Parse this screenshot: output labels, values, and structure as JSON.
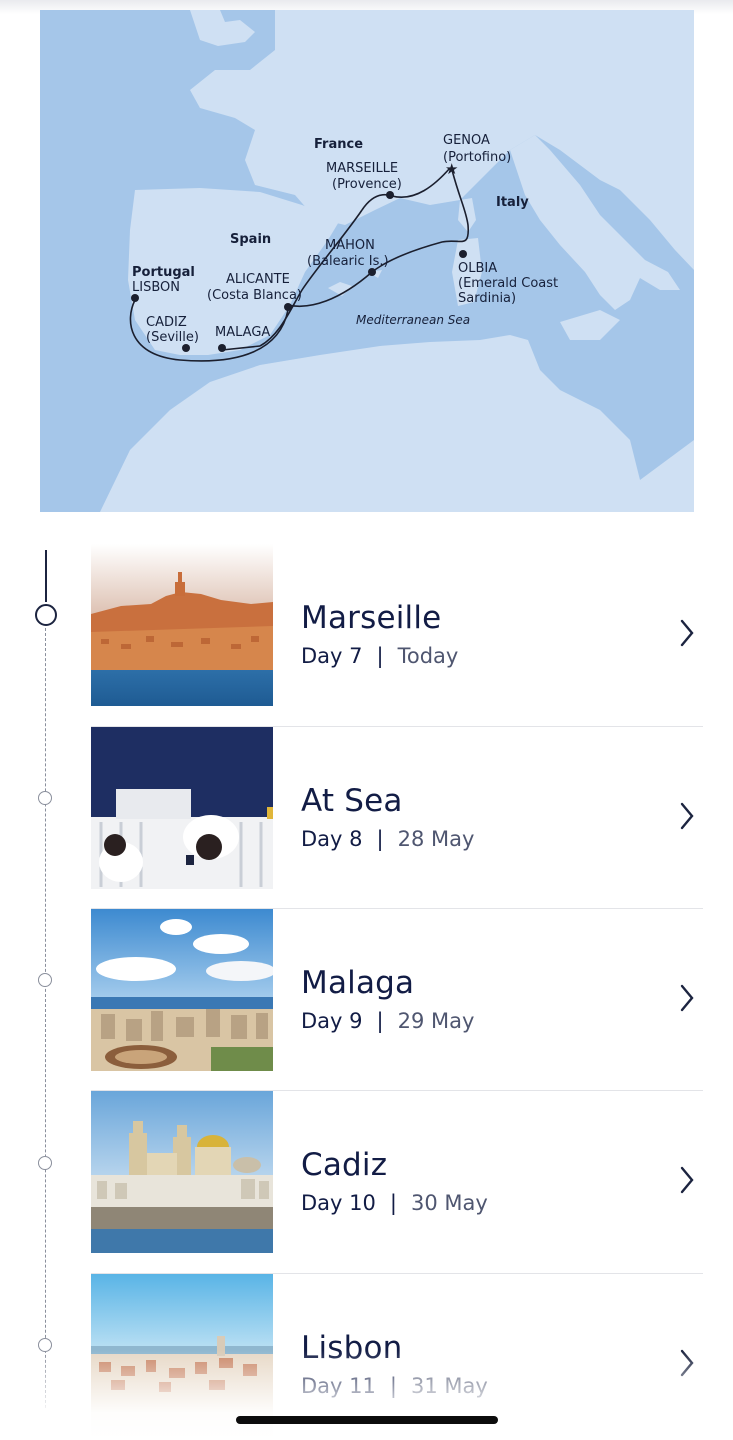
{
  "map": {
    "countries": [
      "France",
      "Spain",
      "Portugal",
      "Italy"
    ],
    "sea": "Mediterranean Sea",
    "ports": [
      {
        "name": "GENOA",
        "sub": "(Portofino)"
      },
      {
        "name": "MARSEILLE",
        "sub": "(Provence)"
      },
      {
        "name": "MAHON",
        "sub": "(Balearic Is.)"
      },
      {
        "name": "ALICANTE",
        "sub": "(Costa Blanca)"
      },
      {
        "name": "OLBIA",
        "sub": "(Emerald Coast",
        "sub2": "Sardinia)"
      },
      {
        "name": "LISBON",
        "sub": ""
      },
      {
        "name": "CADIZ",
        "sub": "(Seville)"
      },
      {
        "name": "MALAGA",
        "sub": ""
      }
    ],
    "colors": {
      "sea": "#a3c5e8",
      "land": "#cfe0f3",
      "route": "#1b1f2e"
    }
  },
  "itinerary": [
    {
      "title": "Marseille",
      "day": "Day 7",
      "date": "Today",
      "image": "marseille-photo",
      "current": true
    },
    {
      "title": "At Sea",
      "day": "Day 8",
      "date": "28 May",
      "image": "at-sea-photo",
      "current": false
    },
    {
      "title": "Malaga",
      "day": "Day 9",
      "date": "29 May",
      "image": "malaga-photo",
      "current": false
    },
    {
      "title": "Cadiz",
      "day": "Day 10",
      "date": "30 May",
      "image": "cadiz-photo",
      "current": false
    },
    {
      "title": "Lisbon",
      "day": "Day 11",
      "date": "31 May",
      "image": "lisbon-photo",
      "current": false
    }
  ],
  "separator": "|",
  "icons": {
    "chevron": "chevron-right-icon",
    "star": "home-port-star-icon"
  }
}
